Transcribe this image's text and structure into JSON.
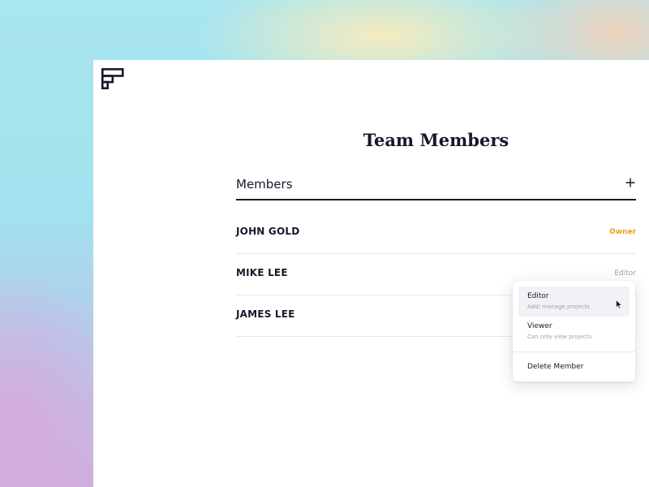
{
  "page": {
    "title": "Team Members"
  },
  "members_section": {
    "label": "Members",
    "add_icon": "plus-icon"
  },
  "members": [
    {
      "name": "JOHN GOLD",
      "role": "Owner"
    },
    {
      "name": "MIKE LEE",
      "role": "Editor"
    },
    {
      "name": "JAMES LEE",
      "role": ""
    }
  ],
  "role_menu": {
    "options": [
      {
        "label": "Editor",
        "description": "Add/ manage projects"
      },
      {
        "label": "Viewer",
        "description": "Can only view projects"
      }
    ],
    "delete_label": "Delete Member"
  },
  "colors": {
    "text_dark": "#151a2a",
    "owner_accent": "#e3a21a",
    "muted": "#9aa3b5"
  }
}
